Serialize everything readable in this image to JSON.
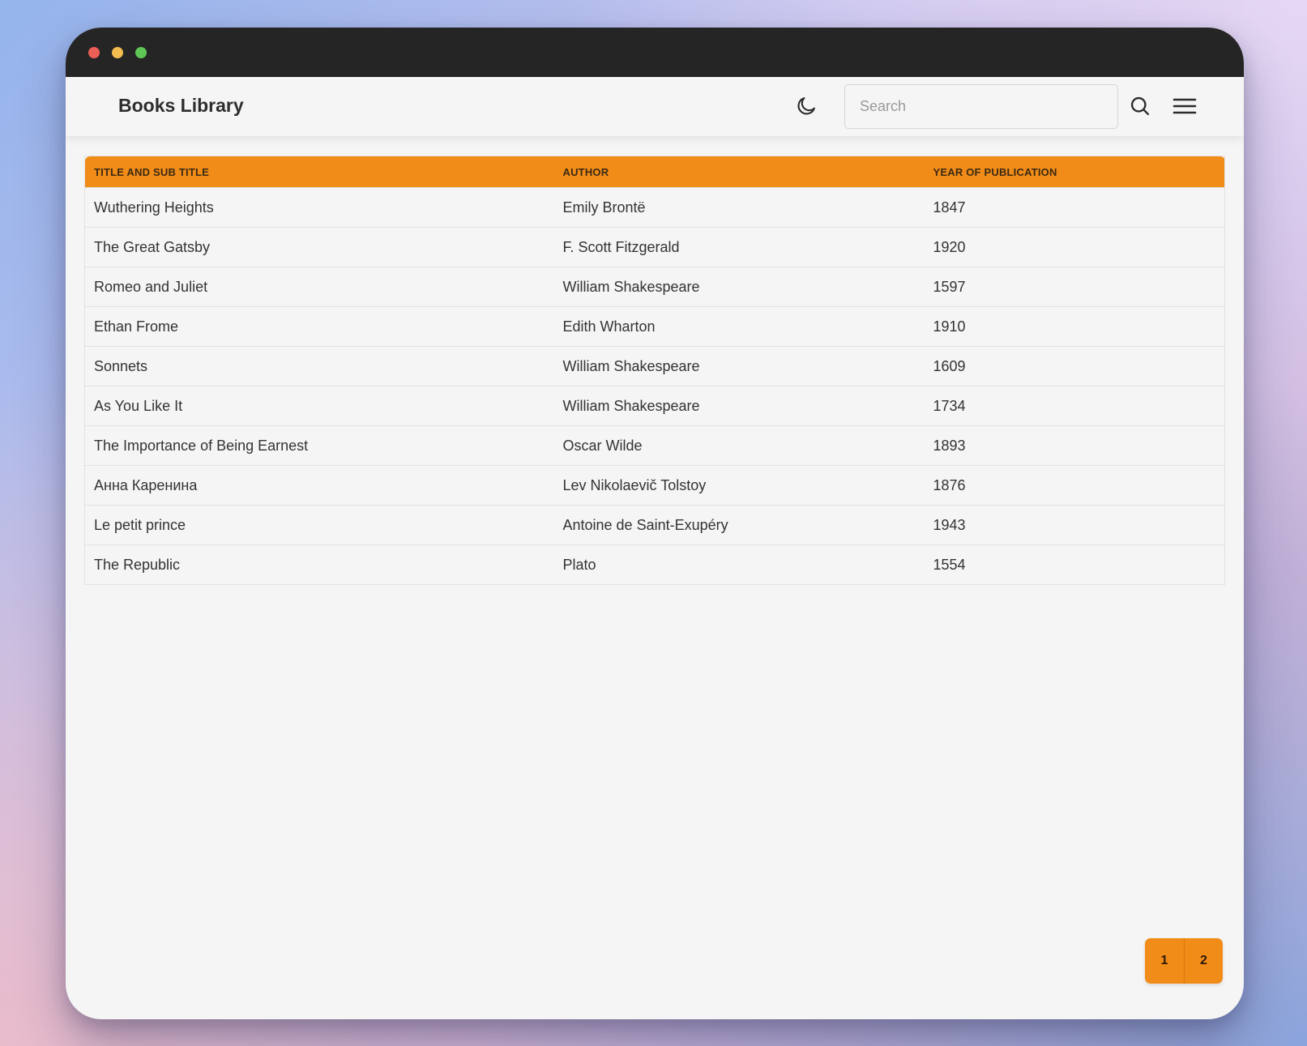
{
  "app": {
    "title": "Books Library"
  },
  "header": {
    "theme_toggle_icon": "moon-icon",
    "search": {
      "placeholder": "Search",
      "value": ""
    },
    "search_icon": "search-icon",
    "menu_icon": "hamburger-menu-icon"
  },
  "table": {
    "columns": [
      "TITLE AND SUB TITLE",
      "AUTHOR",
      "YEAR OF PUBLICATION"
    ],
    "rows": [
      [
        "Wuthering Heights",
        "Emily Brontë",
        "1847"
      ],
      [
        "The Great Gatsby",
        "F. Scott Fitzgerald",
        "1920"
      ],
      [
        "Romeo and Juliet",
        "William Shakespeare",
        "1597"
      ],
      [
        "Ethan Frome",
        "Edith Wharton",
        "1910"
      ],
      [
        "Sonnets",
        "William Shakespeare",
        "1609"
      ],
      [
        "As You Like It",
        "William Shakespeare",
        "1734"
      ],
      [
        "The Importance of Being Earnest",
        "Oscar Wilde",
        "1893"
      ],
      [
        "Анна Каренина",
        "Lev Nikolaevič Tolstoy",
        "1876"
      ],
      [
        "Le petit prince",
        "Antoine de Saint-Exupéry",
        "1943"
      ],
      [
        "The Republic",
        "Plato",
        "1554"
      ]
    ]
  },
  "pagination": {
    "pages": [
      "1",
      "2"
    ]
  },
  "colors": {
    "accent": "#f28c18",
    "titlebar": "#252525",
    "background": "#f5f5f5"
  }
}
